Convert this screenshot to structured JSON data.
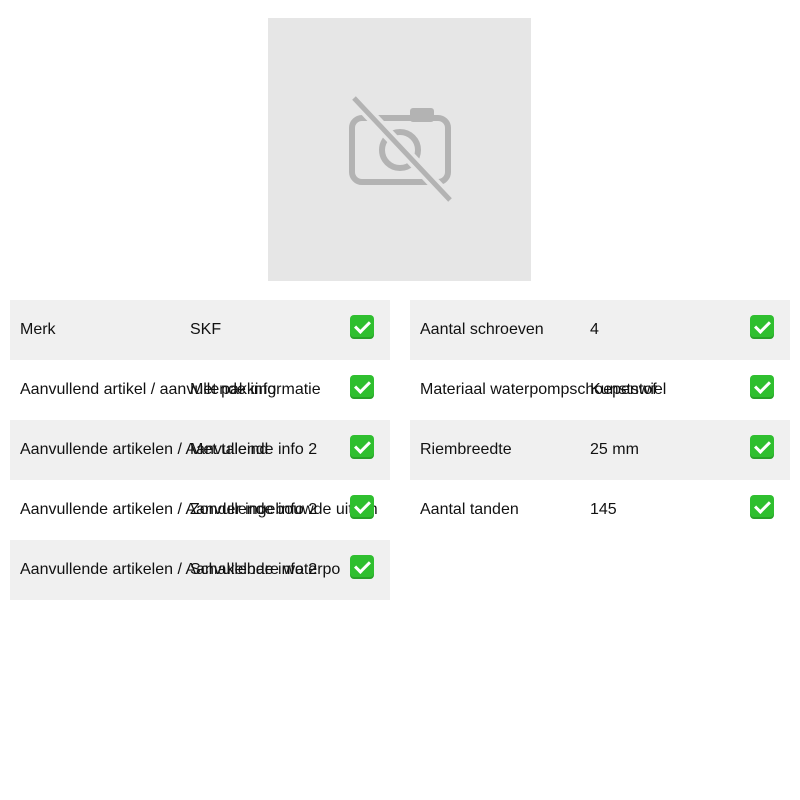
{
  "image": {
    "icon": "no-camera-icon",
    "background": "#e6e6e6"
  },
  "specs_left": [
    {
      "label": "Merk",
      "value": "SKF",
      "status_icon": "check-icon"
    },
    {
      "label": "Aanvullend artikel / aanvullende informatie",
      "value": "Met pakking",
      "status_icon": "check-icon"
    },
    {
      "label": "Aanvullende artikelen / Aanvullende info 2",
      "value": "Met taleind",
      "status_icon": "check-icon"
    },
    {
      "label": "Aanvullende artikelen / Aanvullende info 2",
      "value": "Zonder ingebouwde uitsch",
      "status_icon": "check-icon"
    },
    {
      "label": "Aanvullende artikelen / Aanvullende info 2",
      "value": "Schakelbare waterpo",
      "status_icon": "check-icon"
    }
  ],
  "specs_right": [
    {
      "label": "Aantal schroeven",
      "value": "4",
      "status_icon": "check-icon"
    },
    {
      "label": "Materiaal waterpompschoepenwiel",
      "value": "Kunststof",
      "status_icon": "check-icon"
    },
    {
      "label": "Riembreedte",
      "value": "25 mm",
      "status_icon": "check-icon"
    },
    {
      "label": "Aantal tanden",
      "value": "145",
      "status_icon": "check-icon"
    }
  ],
  "colors": {
    "row_shaded": "#f0f0f0",
    "check_green": "#2fbf2f"
  }
}
